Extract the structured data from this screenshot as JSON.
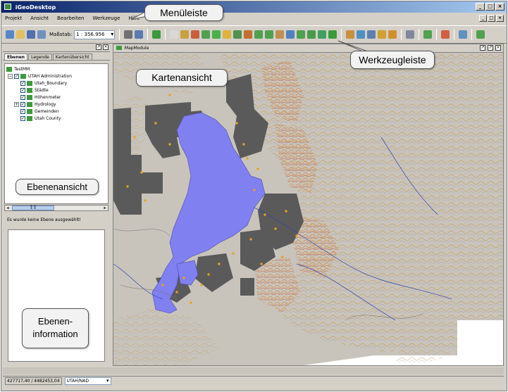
{
  "window": {
    "title": "iGeoDesktop",
    "min": "_",
    "max": "□",
    "close": "×"
  },
  "menubar": {
    "items": [
      "Projekt",
      "Ansicht",
      "Bearbeiten",
      "Werkzeuge",
      "Hilfe"
    ]
  },
  "toolbar": {
    "scale_label": "Maßstab:",
    "scale_value": "1 : 356.956"
  },
  "layers_panel": {
    "tabs": [
      "Ebenen",
      "Legende",
      "Kartenübersicht"
    ],
    "root": "TestMM",
    "group": "UTAH Administration",
    "items": [
      "Utah_Boundary",
      "Städte",
      "Höhenmeter",
      "Hydrology",
      "Gemeinden",
      "Utah County"
    ],
    "scroll_thumb": "⁑ ⁑"
  },
  "info_panel": {
    "message": "Es wurde keine Ebene ausgewählt!"
  },
  "map_panel": {
    "title": "MapModule"
  },
  "statusbar": {
    "coordinates": "427717,40 / 4482453,04",
    "crs": "UTAH/NAD"
  },
  "callouts": {
    "menu": "Menüleiste",
    "map": "Kartenansicht",
    "toolbar": "Werkzeugleiste",
    "layers": "Ebenenansicht",
    "info_line1": "Ebenen-",
    "info_line2": "information"
  },
  "colors": {
    "lake": "#8080f0",
    "admin_area": "#606060",
    "terrain_contour": "#c8a060",
    "background_area": "#c8c4bc"
  }
}
